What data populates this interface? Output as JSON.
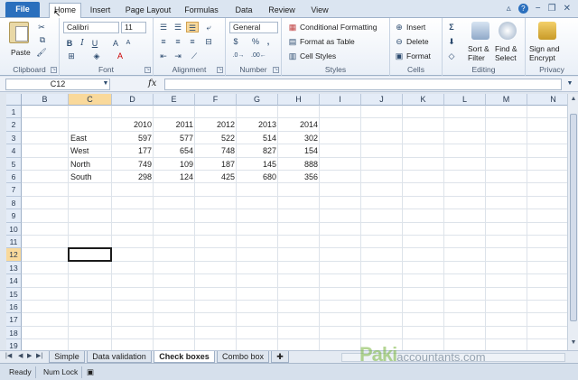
{
  "ribbon_tabs": [
    "File",
    "Home",
    "Insert",
    "Page Layout",
    "Formulas",
    "Data",
    "Review",
    "View"
  ],
  "active_tab": "Home",
  "clipboard": {
    "paste": "Paste",
    "label": "Clipboard"
  },
  "font": {
    "name": "Calibri",
    "size": "11",
    "label": "Font",
    "bold": "B",
    "italic": "I",
    "underline": "U"
  },
  "alignment": {
    "label": "Alignment"
  },
  "number": {
    "format": "General",
    "currency": "$",
    "percent": "%",
    "comma": ",",
    "label": "Number"
  },
  "styles": {
    "conditional": "Conditional Formatting",
    "format_table": "Format as Table",
    "cell_styles": "Cell Styles",
    "label": "Styles"
  },
  "cells": {
    "insert": "Insert",
    "delete": "Delete",
    "format": "Format",
    "label": "Cells"
  },
  "editing": {
    "sort": "Sort &",
    "filter": "Filter",
    "find": "Find &",
    "select": "Select",
    "label": "Editing"
  },
  "privacy": {
    "sign": "Sign and",
    "encrypt": "Encrypt",
    "label": "Privacy"
  },
  "name_box": "C12",
  "fx": "fx",
  "columns": [
    "B",
    "C",
    "D",
    "E",
    "F",
    "G",
    "H",
    "I",
    "J",
    "K",
    "L",
    "M",
    "N"
  ],
  "rows": [
    "1",
    "2",
    "3",
    "4",
    "5",
    "6",
    "7",
    "8",
    "9",
    "10",
    "11",
    "12",
    "13",
    "14",
    "15",
    "16",
    "17",
    "18",
    "19"
  ],
  "table": {
    "years": [
      "2010",
      "2011",
      "2012",
      "2013",
      "2014"
    ],
    "regions": [
      {
        "name": "East",
        "values": [
          "597",
          "577",
          "522",
          "514",
          "302"
        ]
      },
      {
        "name": "West",
        "values": [
          "177",
          "654",
          "748",
          "827",
          "154"
        ]
      },
      {
        "name": "North",
        "values": [
          "749",
          "109",
          "187",
          "145",
          "888"
        ]
      },
      {
        "name": "South",
        "values": [
          "298",
          "124",
          "425",
          "680",
          "356"
        ]
      }
    ]
  },
  "sheets": [
    "Simple",
    "Data validation",
    "Check boxes",
    "Combo box"
  ],
  "active_sheet": "Check boxes",
  "status": {
    "ready": "Ready",
    "numlock": "Num Lock"
  },
  "watermark": {
    "brand": "Paki",
    "rest": "accountants.com"
  }
}
